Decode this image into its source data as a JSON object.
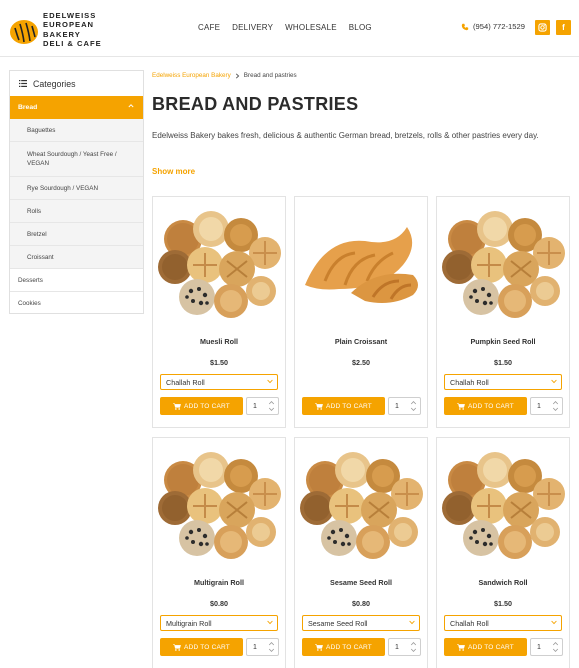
{
  "brand": {
    "lines": [
      "EDELWEISS",
      "EUROPEAN",
      "BAKERY",
      "DELI & CAFE"
    ]
  },
  "nav": [
    "CAFE",
    "DELIVERY",
    "WHOLESALE",
    "BLOG"
  ],
  "contact": {
    "phone": "(954) 772-1529"
  },
  "social": [
    {
      "name": "instagram-icon",
      "glyph": "◎"
    },
    {
      "name": "facebook-icon",
      "glyph": "f"
    }
  ],
  "sidebar": {
    "header": "Categories",
    "active": "Bread",
    "subitems": [
      "Baguettes",
      "Wheat Sourdough / Yeast Free / VEGAN",
      "Rye Sourdough / VEGAN",
      "Rolls",
      "Bretzel",
      "Croissant"
    ],
    "items": [
      "Desserts",
      "Cookies"
    ]
  },
  "breadcrumb": {
    "home": "Edelweiss European Bakery",
    "current": "Bread and pastries"
  },
  "page": {
    "title": "BREAD AND PASTRIES",
    "intro": "Edelweiss Bakery bakes fresh, delicious & authentic German bread, bretzels, rolls & other pastries every day.",
    "show_more": "Show more"
  },
  "cart": {
    "add_label": "ADD TO CART"
  },
  "products": [
    {
      "name": "Muesli Roll",
      "price": "$1.50",
      "option": "Challah Roll",
      "qty": "1",
      "image": "rolls"
    },
    {
      "name": "Plain Croissant",
      "price": "$2.50",
      "option": "",
      "qty": "1",
      "image": "croissant"
    },
    {
      "name": "Pumpkin Seed Roll",
      "price": "$1.50",
      "option": "Challah Roll",
      "qty": "1",
      "image": "rolls"
    },
    {
      "name": "Multigrain Roll",
      "price": "$0.80",
      "option": "Multigrain Roll",
      "qty": "1",
      "image": "rolls"
    },
    {
      "name": "Sesame Seed Roll",
      "price": "$0.80",
      "option": "Sesame Seed Roll",
      "qty": "1",
      "image": "rolls"
    },
    {
      "name": "Sandwich Roll",
      "price": "$1.50",
      "option": "Challah Roll",
      "qty": "1",
      "image": "rolls"
    }
  ],
  "colors": {
    "accent": "#f5a300",
    "text": "#333333",
    "border": "#e3e3e3"
  }
}
